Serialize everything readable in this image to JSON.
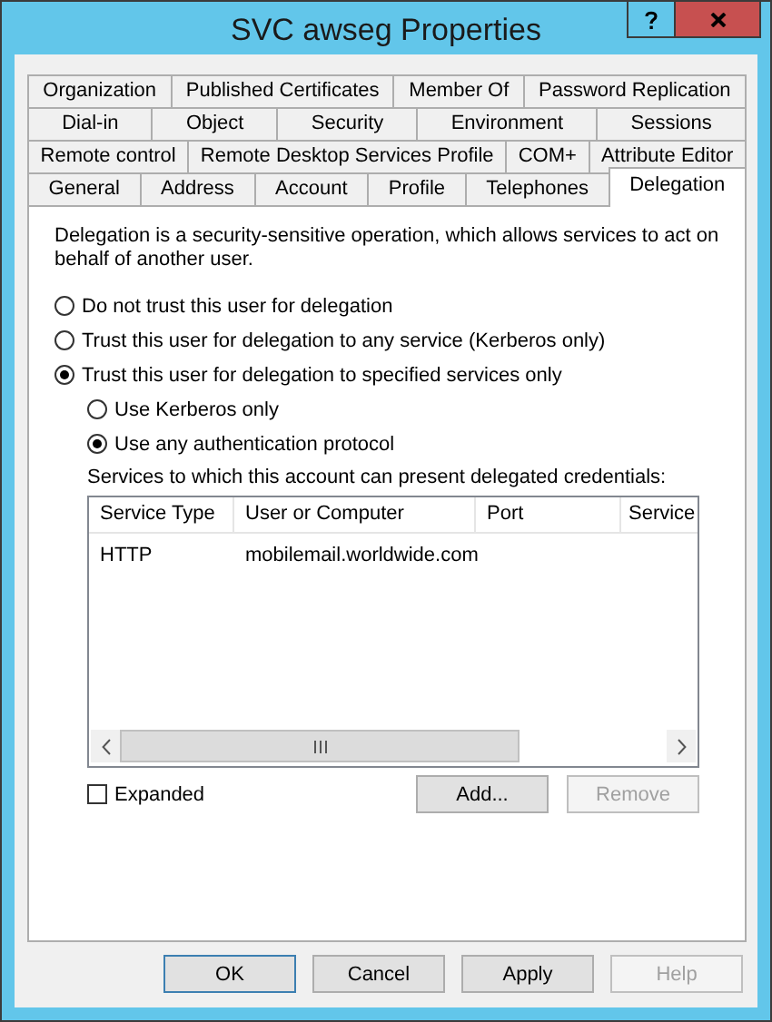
{
  "window": {
    "title": "SVC awseg Properties"
  },
  "tab_rows": [
    [
      {
        "label": "Organization",
        "selected": false
      },
      {
        "label": "Published Certificates",
        "selected": false
      },
      {
        "label": "Member Of",
        "selected": false
      },
      {
        "label": "Password Replication",
        "selected": false
      }
    ],
    [
      {
        "label": "Dial-in",
        "selected": false
      },
      {
        "label": "Object",
        "selected": false
      },
      {
        "label": "Security",
        "selected": false
      },
      {
        "label": "Environment",
        "selected": false
      },
      {
        "label": "Sessions",
        "selected": false
      }
    ],
    [
      {
        "label": "Remote control",
        "selected": false
      },
      {
        "label": "Remote Desktop Services Profile",
        "selected": false
      },
      {
        "label": "COM+",
        "selected": false
      },
      {
        "label": "Attribute Editor",
        "selected": false
      }
    ],
    [
      {
        "label": "General",
        "selected": false
      },
      {
        "label": "Address",
        "selected": false
      },
      {
        "label": "Account",
        "selected": false
      },
      {
        "label": "Profile",
        "selected": false
      },
      {
        "label": "Telephones",
        "selected": false
      },
      {
        "label": "Delegation",
        "selected": true
      }
    ]
  ],
  "description": "Delegation is a security-sensitive operation, which allows services to act on behalf of another user.",
  "delegation_options": [
    {
      "label": "Do not trust this user for delegation",
      "selected": false
    },
    {
      "label": "Trust this user for delegation to any service (Kerberos only)",
      "selected": false
    },
    {
      "label": "Trust this user for delegation to specified services only",
      "selected": true
    }
  ],
  "protocol_options": [
    {
      "label": "Use Kerberos only",
      "selected": false
    },
    {
      "label": "Use any authentication protocol",
      "selected": true
    }
  ],
  "services": {
    "label": "Services to which this account can present delegated credentials:",
    "columns": [
      "Service Type",
      "User or Computer",
      "Port",
      "Service"
    ],
    "rows": [
      [
        "HTTP",
        "mobilemail.worldwide.com",
        "",
        ""
      ]
    ]
  },
  "expanded": {
    "label": "Expanded",
    "checked": false
  },
  "list_buttons": [
    {
      "label": "Add...",
      "disabled": false
    },
    {
      "label": "Remove",
      "disabled": true
    }
  ],
  "footer_buttons": [
    {
      "label": "OK",
      "disabled": false,
      "default": true
    },
    {
      "label": "Cancel",
      "disabled": false,
      "default": false
    },
    {
      "label": "Apply",
      "disabled": false,
      "default": false
    },
    {
      "label": "Help",
      "disabled": true,
      "default": false
    }
  ]
}
